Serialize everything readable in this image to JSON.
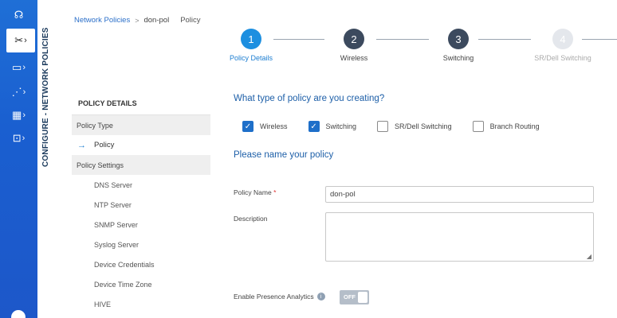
{
  "rail": {
    "items": [
      {
        "icon": "headset-icon",
        "glyph": "☊",
        "chevron": ""
      },
      {
        "icon": "tools-icon",
        "glyph": "✂",
        "chevron": "›"
      },
      {
        "icon": "devices-icon",
        "glyph": "▭",
        "chevron": "›"
      },
      {
        "icon": "analytics-icon",
        "glyph": "⋰",
        "chevron": "›"
      },
      {
        "icon": "grid-icon",
        "glyph": "▦",
        "chevron": "›"
      },
      {
        "icon": "lock-icon",
        "glyph": "⊡",
        "chevron": "›"
      }
    ]
  },
  "vertical_label": "CONFIGURE - NETWORK POLICIES",
  "breadcrumb": {
    "link": "Network Policies",
    "sep": ">",
    "current": "don-pol",
    "page": "Policy"
  },
  "steps": [
    {
      "num": "1",
      "label": "Policy Details"
    },
    {
      "num": "2",
      "label": "Wireless"
    },
    {
      "num": "3",
      "label": "Switching"
    },
    {
      "num": "4",
      "label": "SR/Dell Switching"
    }
  ],
  "subnav": {
    "header": "POLICY DETAILS",
    "section1": "Policy Type",
    "current": "Policy",
    "section2": "Policy Settings",
    "items": [
      "DNS Server",
      "NTP Server",
      "SNMP Server",
      "Syslog Server",
      "Device Credentials",
      "Device Time Zone",
      "HIVE"
    ]
  },
  "form": {
    "type_question": "What type of policy are you creating?",
    "types": [
      {
        "label": "Wireless",
        "checked": true
      },
      {
        "label": "Switching",
        "checked": true
      },
      {
        "label": "SR/Dell Switching",
        "checked": false
      },
      {
        "label": "Branch Routing",
        "checked": false
      }
    ],
    "name_heading": "Please name your policy",
    "policy_name_label": "Policy Name",
    "required_mark": "*",
    "policy_name_value": "don-pol",
    "description_label": "Description",
    "description_value": "",
    "presence_label": "Enable Presence Analytics",
    "presence_toggle": "OFF"
  },
  "colors": {
    "rail": "#1d5fd0",
    "accent": "#1d8fe0",
    "heading": "#1d5fa8"
  }
}
